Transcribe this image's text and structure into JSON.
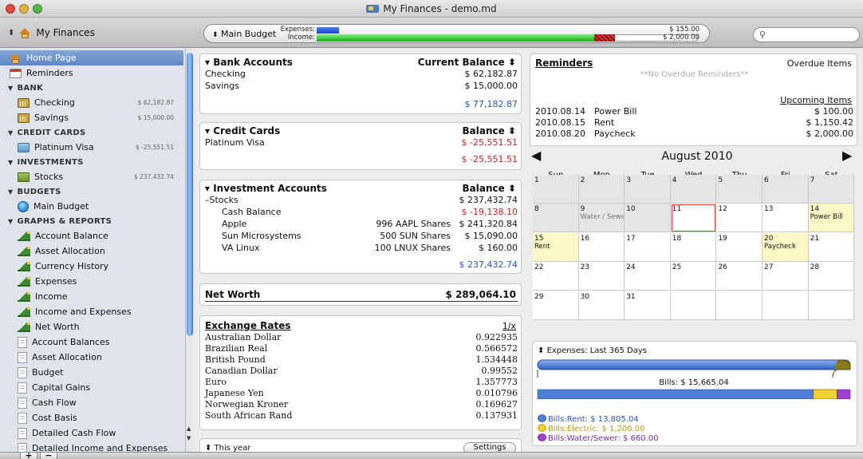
{
  "window": {
    "title": "My Finances - demo.md"
  },
  "toolbar": {
    "source_label": "My Finances",
    "budget_name": "Main Budget",
    "expenses_label": "Expenses:",
    "income_label": "Income:",
    "expenses_value": "$ 155.00",
    "income_value": "$ 2,000.00",
    "expenses_fraction": 0.078,
    "search_placeholder": ""
  },
  "sidebar": {
    "home": "Home Page",
    "reminders": "Reminders",
    "bank_header": "BANK",
    "bank": [
      {
        "label": "Checking",
        "balance": "$ 62,182.87"
      },
      {
        "label": "Savings",
        "balance": "$ 15,000.00"
      }
    ],
    "credit_header": "CREDIT CARDS",
    "credit": [
      {
        "label": "Platinum Visa",
        "balance": "$ -25,551.51"
      }
    ],
    "invest_header": "INVESTMENTS",
    "invest": [
      {
        "label": "Stocks",
        "balance": "$ 237,432.74"
      }
    ],
    "budgets_header": "BUDGETS",
    "budgets": [
      {
        "label": "Main Budget"
      }
    ],
    "graphs_header": "GRAPHS & REPORTS",
    "graphs": [
      "Account Balance",
      "Asset Allocation",
      "Currency History",
      "Expenses",
      "Income",
      "Income and Expenses",
      "Net Worth"
    ],
    "reports": [
      "Account Balances",
      "Asset Allocation",
      "Budget",
      "Capital Gains",
      "Cash Flow",
      "Cost Basis",
      "Detailed Cash Flow",
      "Detailed Income and Expenses"
    ]
  },
  "bank_accounts": {
    "title": "Bank Accounts",
    "col": "Current Balance",
    "rows": [
      {
        "name": "Checking",
        "value": "$ 62,182.87"
      },
      {
        "name": "Savings",
        "value": "$ 15,000.00"
      }
    ],
    "total": "$ 77,182.87"
  },
  "credit_cards": {
    "title": "Credit Cards",
    "col": "Balance",
    "rows": [
      {
        "name": "Platinum Visa",
        "value": "$ -25,551.51"
      }
    ],
    "total": "$ -25,551.51"
  },
  "investments": {
    "title": "Investment Accounts",
    "col": "Balance",
    "group": "Stocks",
    "group_value": "$ 237,432.74",
    "cash_label": "Cash Balance",
    "cash_value": "$ -19,138.10",
    "rows": [
      {
        "name": "Apple",
        "shares": "996 AAPL Shares",
        "value": "$ 241,320.84"
      },
      {
        "name": "Sun Microsystems",
        "shares": "500 SUN Shares",
        "value": "$ 15,090.00"
      },
      {
        "name": "VA Linux",
        "shares": "100 LNUX Shares",
        "value": "$ 160.00"
      }
    ],
    "total": "$ 237,432.74"
  },
  "net_worth": {
    "label": "Net Worth",
    "value": "$ 289,064.10"
  },
  "exchange": {
    "title": "Exchange Rates",
    "toggle": "1/x",
    "rows": [
      {
        "name": "Australian Dollar",
        "value": "0.922935"
      },
      {
        "name": "Brazilian Real",
        "value": "0.566572"
      },
      {
        "name": "British Pound",
        "value": "1.534448"
      },
      {
        "name": "Canadian Dollar",
        "value": "0.99552"
      },
      {
        "name": "Euro",
        "value": "1.357773"
      },
      {
        "name": "Japanese Yen",
        "value": "0.010796"
      },
      {
        "name": "Norwegian Kroner",
        "value": "0.169627"
      },
      {
        "name": "South African Rand",
        "value": "0.137931"
      }
    ]
  },
  "this_year": {
    "label": "This year",
    "settings": "Settings"
  },
  "reminders": {
    "title": "Reminders",
    "overdue": "Overdue Items",
    "none": "**No Overdue Reminders**",
    "upcoming": "Upcoming Items",
    "rows": [
      {
        "date": "2010.08.14",
        "name": "Power Bill",
        "value": "$ 100.00"
      },
      {
        "date": "2010.08.15",
        "name": "Rent",
        "value": "$ 1,150.42"
      },
      {
        "date": "2010.08.20",
        "name": "Paycheck",
        "value": "$ 2,000.00"
      }
    ]
  },
  "calendar": {
    "month": "August 2010",
    "days": [
      "Sun",
      "Mon",
      "Tue",
      "Wed",
      "Thu",
      "Fri",
      "Sat"
    ],
    "cells": [
      {
        "n": "1",
        "e": "",
        "s": "grey"
      },
      {
        "n": "2",
        "e": "",
        "s": "grey"
      },
      {
        "n": "3",
        "e": "",
        "s": "grey"
      },
      {
        "n": "4",
        "e": "",
        "s": "grey"
      },
      {
        "n": "5",
        "e": "",
        "s": "grey"
      },
      {
        "n": "6",
        "e": "",
        "s": "grey"
      },
      {
        "n": "7",
        "e": "",
        "s": "grey"
      },
      {
        "n": "8",
        "e": "",
        "s": "grey"
      },
      {
        "n": "9",
        "e": "Water / Sewe",
        "s": "grey"
      },
      {
        "n": "10",
        "e": "",
        "s": "grey"
      },
      {
        "n": "11",
        "e": "",
        "s": "today"
      },
      {
        "n": "12",
        "e": "",
        "s": ""
      },
      {
        "n": "13",
        "e": "",
        "s": ""
      },
      {
        "n": "14",
        "e": "Power Bill",
        "s": "yel"
      },
      {
        "n": "15",
        "e": "Rent",
        "s": "yel"
      },
      {
        "n": "16",
        "e": "",
        "s": ""
      },
      {
        "n": "17",
        "e": "",
        "s": ""
      },
      {
        "n": "18",
        "e": "",
        "s": ""
      },
      {
        "n": "19",
        "e": "",
        "s": ""
      },
      {
        "n": "20",
        "e": "Paycheck",
        "s": "yel"
      },
      {
        "n": "21",
        "e": "",
        "s": ""
      },
      {
        "n": "22",
        "e": "",
        "s": ""
      },
      {
        "n": "23",
        "e": "",
        "s": ""
      },
      {
        "n": "24",
        "e": "",
        "s": ""
      },
      {
        "n": "25",
        "e": "",
        "s": ""
      },
      {
        "n": "26",
        "e": "",
        "s": ""
      },
      {
        "n": "27",
        "e": "",
        "s": ""
      },
      {
        "n": "28",
        "e": "",
        "s": ""
      },
      {
        "n": "29",
        "e": "",
        "s": ""
      },
      {
        "n": "30",
        "e": "",
        "s": ""
      },
      {
        "n": "31",
        "e": "",
        "s": ""
      },
      {
        "n": "",
        "e": "",
        "s": ""
      },
      {
        "n": "",
        "e": "",
        "s": ""
      },
      {
        "n": "",
        "e": "",
        "s": ""
      },
      {
        "n": "",
        "e": "",
        "s": ""
      }
    ]
  },
  "expenses_chart": {
    "title": "Expenses: Last 365 Days",
    "total": "Bills: $ 15,665.04",
    "segments": [
      {
        "label": "Bills:Rent: $ 13,805.04",
        "value": 13805.04,
        "color": "#4d7fd8"
      },
      {
        "label": "Bills:Electric: $ 1,200.00",
        "value": 1200.0,
        "color": "#f0d030"
      },
      {
        "label": "Bills:Water/Sewer: $ 660.00",
        "value": 660.0,
        "color": "#a040d0"
      }
    ]
  }
}
